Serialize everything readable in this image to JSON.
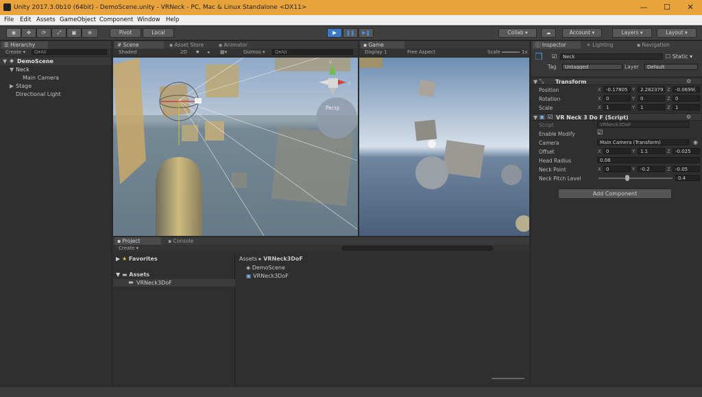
{
  "window": {
    "title": "Unity 2017.3.0b10 (64bit) - DemoScene.unity - VRNeck - PC, Mac & Linux Standalone <DX11>"
  },
  "menu": [
    "File",
    "Edit",
    "Assets",
    "GameObject",
    "Component",
    "Window",
    "Help"
  ],
  "toolbar": {
    "pivot": "Pivot",
    "local": "Local",
    "collab": "Collab ▾",
    "account": "Account",
    "layers": "Layers",
    "layout": "Layout"
  },
  "hierarchy": {
    "tab": "Hierarchy",
    "create": "Create ▾",
    "search": "Q▾All",
    "scene": "DemoScene",
    "items": [
      "Neck",
      "Main Camera",
      "Stage",
      "Directional Light"
    ]
  },
  "scene": {
    "tabs": [
      "Scene",
      "Asset Store",
      "Animator"
    ],
    "shaded": "Shaded",
    "mode2d": "2D",
    "gizmos": "Gizmos ▾",
    "search": "Q▾All",
    "persp": "Persp"
  },
  "game": {
    "tab": "Game",
    "display": "Display 1",
    "aspect": "Free Aspect",
    "scale": "Scale",
    "scale_val": "1x"
  },
  "inspector": {
    "tabs": [
      "Inspector",
      "Lighting",
      "Navigation"
    ],
    "object_name": "Neck",
    "static": "Static",
    "tag_label": "Tag",
    "tag": "Untagged",
    "layer_label": "Layer",
    "layer": "Default",
    "transform": {
      "title": "Transform",
      "rows": [
        {
          "label": "Position",
          "x": "-0.17805",
          "y": "2.282379",
          "z": "-0.0699("
        },
        {
          "label": "Rotation",
          "x": "0",
          "y": "0",
          "z": "0"
        },
        {
          "label": "Scale",
          "x": "1",
          "y": "1",
          "z": "1"
        }
      ]
    },
    "script": {
      "title": "VR Neck 3 Do F (Script)",
      "script_label": "Script",
      "script_value": "VRNeck3DoF",
      "enable_label": "Enable Modify",
      "camera_label": "Camera",
      "camera_value": "Main Camera (Transform)",
      "offset_label": "Offset",
      "offset": {
        "x": "0",
        "y": "1.1",
        "z": "-0.025"
      },
      "radius_label": "Head Radius",
      "radius": "0.08",
      "neckpoint_label": "Neck Point",
      "neckpoint": {
        "x": "0",
        "y": "-0.2",
        "z": "-0.05"
      },
      "pitch_label": "Neck Pitch Level",
      "pitch": "0.4"
    },
    "add_component": "Add Component"
  },
  "project": {
    "tabs": [
      "Project",
      "Console"
    ],
    "create": "Create ▾",
    "favorites": "Favorites",
    "assets": "Assets",
    "folder": "VRNeck3DoF",
    "breadcrumb_root": "Assets",
    "breadcrumb_folder": "VRNeck3DoF",
    "files": [
      "DemoScene",
      "VRNeck3DoF"
    ]
  },
  "colors": {
    "accent_blue": "#3c78c8",
    "titlebar": "#e8a33c",
    "panel": "#2f2f2f"
  }
}
